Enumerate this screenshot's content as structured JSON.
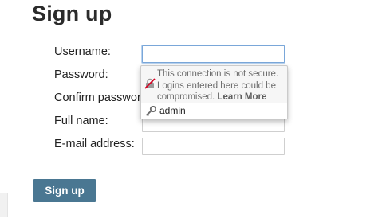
{
  "page": {
    "title": "Sign up"
  },
  "form": {
    "username_label": "Username:",
    "password_label": "Password:",
    "confirm_password_label": "Confirm password:",
    "full_name_label": "Full name:",
    "email_label": "E-mail address:",
    "username_value": "",
    "full_name_value": "",
    "email_value": "",
    "submit_label": "Sign up"
  },
  "popup": {
    "warning_text": "This connection is not secure. Logins entered here could be compromised.",
    "learn_more_label": "Learn More",
    "saved_login": "admin",
    "icons": [
      "insecure-lock-icon",
      "key-icon"
    ]
  },
  "colors": {
    "submit_button": "#4a7792",
    "focus_ring": "#7aa7d9"
  }
}
